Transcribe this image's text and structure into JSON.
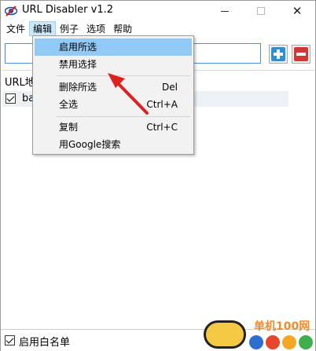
{
  "window": {
    "title": "URL Disabler v1.2",
    "close_glyph": "✕"
  },
  "menubar": {
    "items": [
      "文件",
      "编辑",
      "例子",
      "选项",
      "帮助"
    ],
    "active_index": 1
  },
  "toolbar": {
    "url_value": "",
    "add_icon": "plus-icon",
    "remove_icon": "minus-icon",
    "add_color": "#2d8fd6",
    "remove_color": "#d43535"
  },
  "list": {
    "header": "URL地",
    "rows": [
      {
        "checked": true,
        "text": "ba"
      }
    ]
  },
  "bottom": {
    "whitelist_label": "启用白名单",
    "whitelist_checked": true
  },
  "dropdown": {
    "items": [
      {
        "label": "启用所选",
        "shortcut": "",
        "highlighted": true
      },
      {
        "label": "禁用选择",
        "shortcut": ""
      },
      {
        "label": "删除所选",
        "shortcut": "Del"
      },
      {
        "label": "全选",
        "shortcut": "Ctrl+A"
      },
      {
        "label": "复制",
        "shortcut": "Ctrl+C"
      },
      {
        "label": "用Google搜索",
        "shortcut": ""
      }
    ]
  },
  "watermark": {
    "text": "单机100网"
  },
  "colors": {
    "highlight": "#91c9f7",
    "menu_active": "#cce8ff",
    "arrow": "#e0201f"
  }
}
